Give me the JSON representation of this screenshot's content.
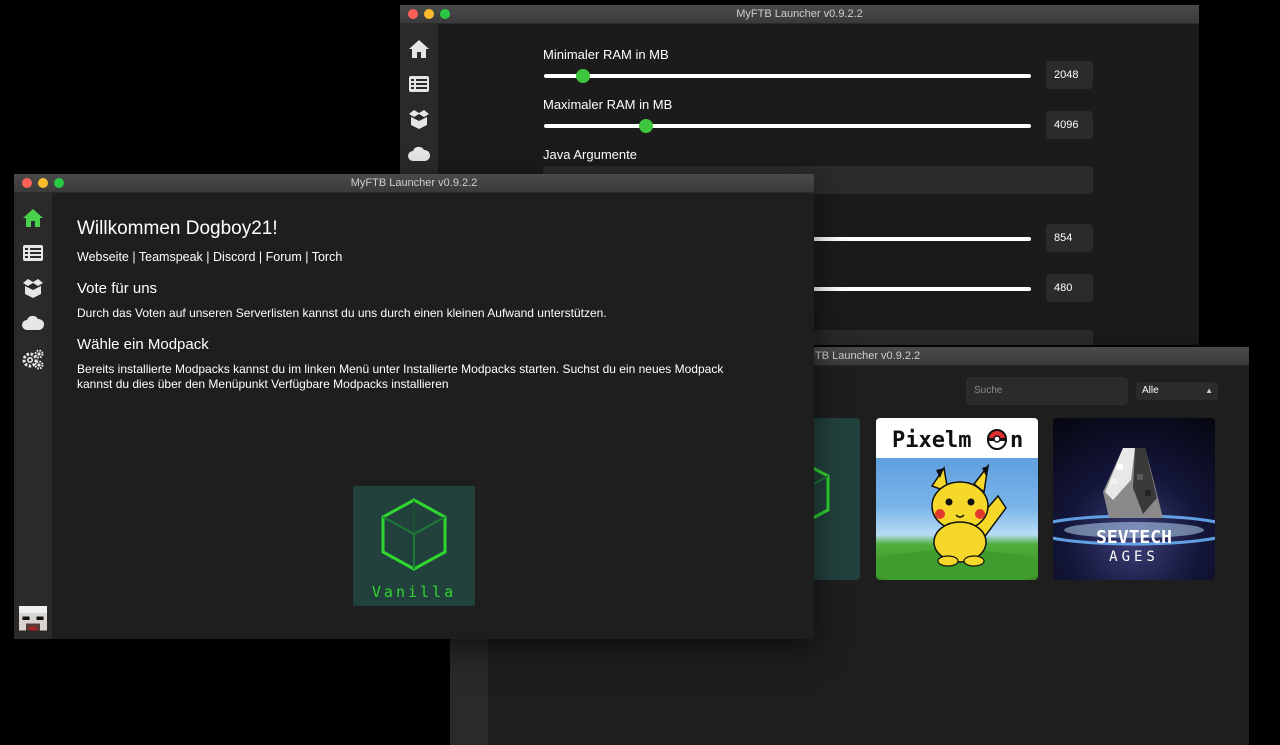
{
  "settings_window": {
    "title": "MyFTB Launcher v0.9.2.2",
    "min_ram": {
      "label": "Minimaler RAM in MB",
      "value": "2048",
      "level": 0.08
    },
    "max_ram": {
      "label": "Maximaler RAM in MB",
      "value": "4096",
      "level": 0.21
    },
    "java_args": {
      "label": "Java Argumente",
      "value": ""
    },
    "width": {
      "value": "854"
    },
    "height": {
      "value": "480"
    }
  },
  "mods_window": {
    "title": "MyFTB Launcher v0.9.2.2",
    "title_visible": "TB Launcher v0.9.2.2",
    "search_placeholder": "Suche",
    "filter_selected": "Alle",
    "modpacks": [
      {
        "name": "Pixelmon",
        "logo_text": "Pixelm",
        "logo_text_end": "n"
      },
      {
        "name": "SevTech Ages",
        "line1": "SEVTECH",
        "line2": "AGES"
      }
    ]
  },
  "home_window": {
    "title": "MyFTB Launcher v0.9.2.2",
    "welcome": "Willkommen Dogboy21!",
    "links": [
      "Webseite",
      "Teamspeak",
      "Discord",
      "Forum",
      "Torch"
    ],
    "separator": "|",
    "vote_heading": "Vote für uns",
    "vote_text": "Durch das Voten auf unseren Serverlisten kannst du uns durch einen kleinen Aufwand unterstützen.",
    "modpack_heading": "Wähle ein Modpack",
    "modpack_text_1": "Bereits installierte Modpacks kannst du im linken Menü unter Installierte Modpacks starten. Suchst du ein neues Modpack",
    "modpack_text_2": "kannst du dies über den Menüpunkt Verfügbare Modpacks installieren",
    "installed_modpack": "Vanilla"
  },
  "sidebar_icons": [
    "home-icon",
    "list-icon",
    "box-icon",
    "cloud-icon",
    "gears-icon"
  ],
  "colors": {
    "accent": "#3ec73e",
    "vanilla_green": "#2fd62f",
    "active_icon": "#49d14b"
  }
}
